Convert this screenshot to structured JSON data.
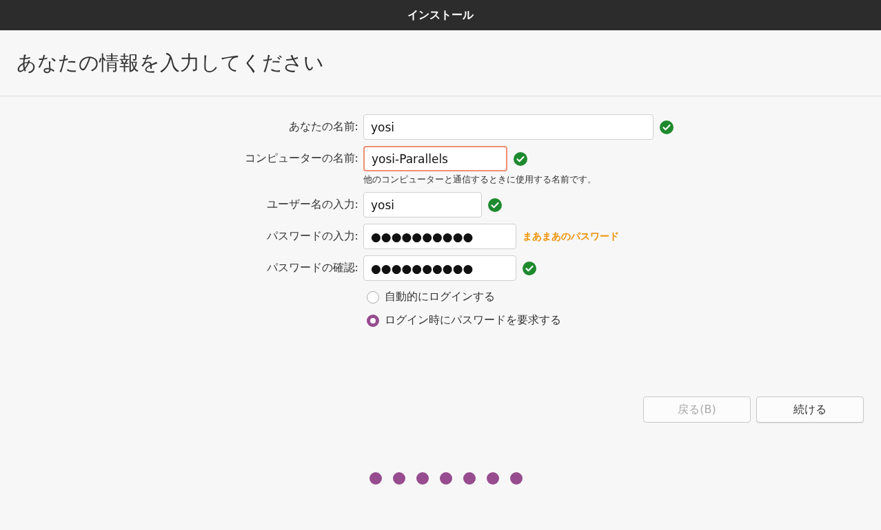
{
  "window": {
    "title": "インストール"
  },
  "heading": "あなたの情報を入力してください",
  "fields": [
    {
      "label": "あなたの名前:",
      "value": "yosi",
      "focused": false,
      "status": {
        "kind": "ok"
      }
    },
    {
      "label": "コンピューターの名前:",
      "value": "yosi-Parallels",
      "focused": true,
      "status": {
        "kind": "ok"
      },
      "hint": "他のコンピューターと通信するときに使用する名前です。"
    },
    {
      "label": "ユーザー名の入力:",
      "value": "yosi",
      "focused": false,
      "status": {
        "kind": "ok"
      }
    },
    {
      "label": "パスワードの入力:",
      "value": "●●●●●●●●●●",
      "focused": false,
      "status": {
        "kind": "strength",
        "text": "まあまあのパスワード"
      }
    },
    {
      "label": "パスワードの確認:",
      "value": "●●●●●●●●●●",
      "focused": false,
      "status": {
        "kind": "ok"
      }
    }
  ],
  "login_options": [
    {
      "label": "自動的にログインする",
      "selected": false
    },
    {
      "label": "ログイン時にパスワードを要求する",
      "selected": true
    }
  ],
  "buttons": [
    {
      "label": "戻る(B)",
      "disabled": true
    },
    {
      "label": "続ける",
      "disabled": false
    }
  ],
  "progress_steps": [
    {
      "done": true
    },
    {
      "done": true
    },
    {
      "done": true
    },
    {
      "done": true
    },
    {
      "done": true
    },
    {
      "done": true
    },
    {
      "done": true
    }
  ]
}
